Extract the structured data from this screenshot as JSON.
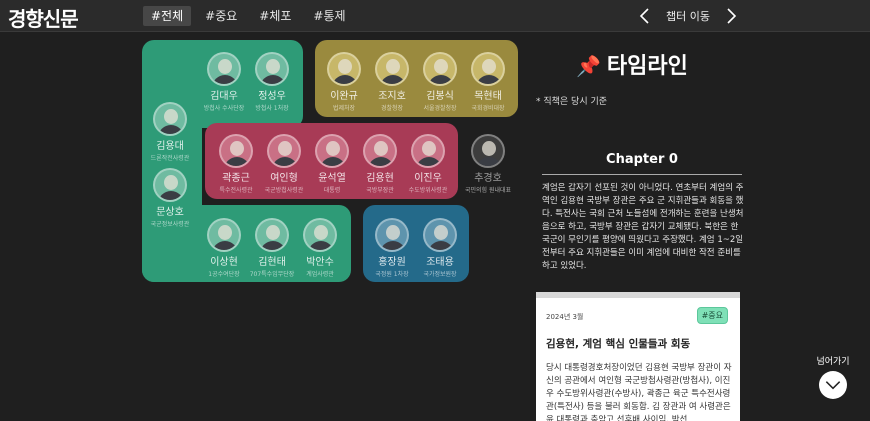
{
  "header": {
    "logo": "경향신문",
    "tabs": [
      {
        "label": "#전체",
        "active": true
      },
      {
        "label": "#중요",
        "active": false
      },
      {
        "label": "#체포",
        "active": false
      },
      {
        "label": "#통제",
        "active": false
      }
    ],
    "chapter_nav_label": "챕터 이동"
  },
  "diagram": {
    "people": [
      {
        "name": "김대우",
        "role": "방첩사 수사단장"
      },
      {
        "name": "정성우",
        "role": "방첩사 1처장"
      },
      {
        "name": "김용대",
        "role": "드론작전사령관"
      },
      {
        "name": "문상호",
        "role": "국군정보사령관"
      },
      {
        "name": "이상현",
        "role": "1공수여단장"
      },
      {
        "name": "김현태",
        "role": "707특수임무단장"
      },
      {
        "name": "박안수",
        "role": "계엄사령관"
      },
      {
        "name": "이완규",
        "role": "법제처장"
      },
      {
        "name": "조지호",
        "role": "경찰청장"
      },
      {
        "name": "김봉식",
        "role": "서울경찰청장"
      },
      {
        "name": "목현태",
        "role": "국회경비대장"
      },
      {
        "name": "곽종근",
        "role": "특수전사령관"
      },
      {
        "name": "여인형",
        "role": "국군방첩사령관"
      },
      {
        "name": "윤석열",
        "role": "대통령"
      },
      {
        "name": "김용현",
        "role": "국방부장관"
      },
      {
        "name": "이진우",
        "role": "수도방위사령관"
      },
      {
        "name": "추경호",
        "role": "국민의힘 원내대표"
      },
      {
        "name": "홍장원",
        "role": "국정원 1차장"
      },
      {
        "name": "조태용",
        "role": "국가정보원장"
      }
    ]
  },
  "timeline": {
    "title": "타임라인",
    "pin_icon": "📌",
    "note": "* 직책은 당시 기준",
    "chapter_title": "Chapter 0",
    "chapter_text": "계엄은 갑자기 선포된 것이 아니었다. 연초부터 계엄의 주역인 김용현 국방부 장관은 주요 군 지휘관들과 회동을 했다. 특전사는 국회 근처 노들섬에 전개하는 훈련을 난생처음으로 하고, 국방부 장관은 갑자기 교체됐다. 북한은 한국군이 무인기를 평양에 띄웠다고 주장했다. 계엄 1~2일 전부터 주요 지휘관들은 이미 계엄에 대비한 작전 준비를 하고 있었다.",
    "card": {
      "date": "2024년 3월",
      "tag": "#중요",
      "headline": "김용현, 계엄 핵심 인물들과 회동",
      "body": "당시 대통령경호처장이었던 김용현 국방부 장관이 자신의 공관에서 여인형 국군방첩사령관(방첩사), 이진우 수도방위사령관(수방사), 곽종근 육군 특수전사령관(특전사) 등을 불러 회동함. 김 장관과 여 사령관은 윤 대통령과 충암고 선후배 사이임. 박선"
    }
  },
  "next": {
    "label": "넘어가기"
  },
  "colors": {
    "green_group": "#2e9b77",
    "yellow_group": "#9a8a3e",
    "red_group": "#a83b56",
    "blue_group": "#246a8a",
    "card_tag": "#7fe0b7"
  }
}
